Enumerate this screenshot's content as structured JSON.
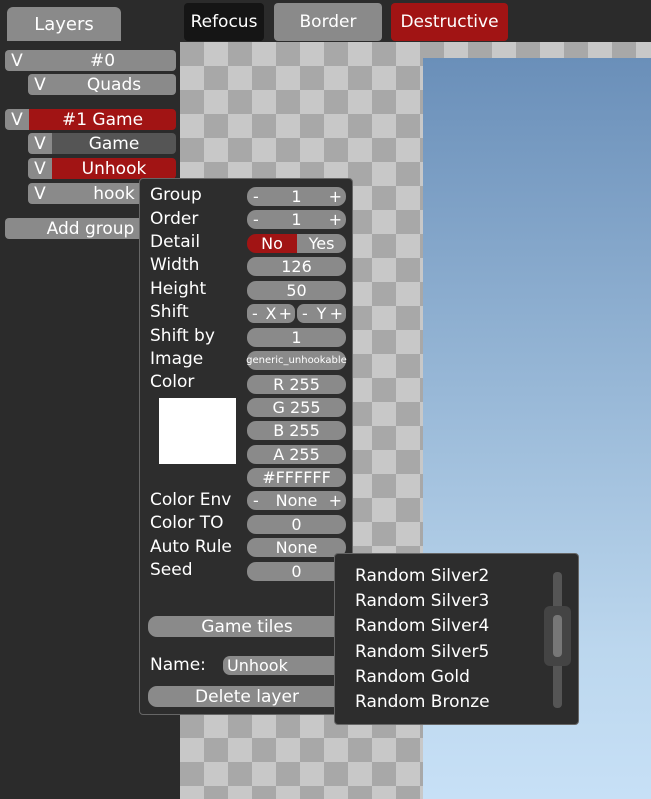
{
  "sidebar": {
    "tab_label": "Layers",
    "visibility_toggle": "V",
    "group0": {
      "title": "#0",
      "layers": [
        "Quads"
      ]
    },
    "group1": {
      "title": "#1 Game",
      "layers": [
        "Game",
        "Unhook",
        "hook"
      ]
    },
    "add_group_label": "Add group"
  },
  "toolbar": {
    "refocus_label": "Refocus",
    "border_label": "Border",
    "destructive_label": "Destructive"
  },
  "layer_properties": {
    "group": {
      "label": "Group",
      "value": "1"
    },
    "order": {
      "label": "Order",
      "value": "1"
    },
    "detail": {
      "label": "Detail",
      "no": "No",
      "yes": "Yes"
    },
    "width": {
      "label": "Width",
      "value": "126"
    },
    "height": {
      "label": "Height",
      "value": "50"
    },
    "shift": {
      "label": "Shift",
      "x": "X",
      "y": "Y"
    },
    "shift_by": {
      "label": "Shift by",
      "value": "1"
    },
    "image": {
      "label": "Image",
      "value": "generic_unhookable"
    },
    "color": {
      "label": "Color",
      "r": "R 255",
      "g": "G 255",
      "b": "B 255",
      "a": "A 255",
      "hex": "#FFFFFF",
      "swatch": "#FFFFFF"
    },
    "color_env": {
      "label": "Color Env",
      "value": "None"
    },
    "color_to": {
      "label": "Color TO",
      "value": "0"
    },
    "auto_rule": {
      "label": "Auto Rule",
      "value": "None"
    },
    "seed": {
      "label": "Seed",
      "value": "0"
    },
    "game_tiles_label": "Game tiles",
    "name": {
      "label": "Name:",
      "value": "Unhook"
    },
    "delete_label": "Delete layer",
    "minus": "-",
    "plus": "+"
  },
  "auto_rule_options": [
    "Random Silver2",
    "Random Silver3",
    "Random Silver4",
    "Random Silver5",
    "Random Gold",
    "Random Bronze"
  ],
  "colors": {
    "accent_red": "#A11414",
    "button_gray": "#8A8A8A",
    "panel_bg": "#2D2D2D"
  }
}
